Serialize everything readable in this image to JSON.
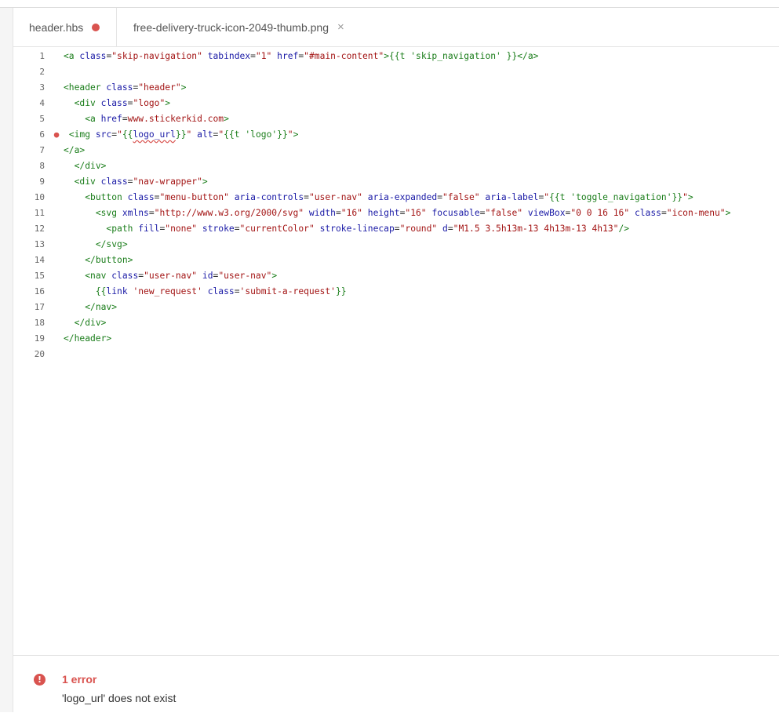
{
  "tabs": [
    {
      "label": "header.hbs",
      "modified": true
    },
    {
      "label": "free-delivery-truck-icon-2049-thumb.png",
      "close": "×"
    }
  ],
  "editor": {
    "lines": [
      {
        "n": "1",
        "html": "<span class=\"tag\">&lt;a</span> <span class=\"an\">class</span>=<span class=\"av\">\"skip-navigation\"</span> <span class=\"an\">tabindex</span>=<span class=\"av\">\"1\"</span> <span class=\"an\">href</span>=<span class=\"av\">\"#main-content\"</span><span class=\"tag\">&gt;</span><span class=\"hb\">{{t 'skip_navigation' }}</span><span class=\"tag\">&lt;/a&gt;</span>"
      },
      {
        "n": "2",
        "html": ""
      },
      {
        "n": "3",
        "html": "<span class=\"tag\">&lt;header</span> <span class=\"an\">class</span>=<span class=\"av\">\"header\"</span><span class=\"tag\">&gt;</span>"
      },
      {
        "n": "4",
        "html": "  <span class=\"tag\">&lt;div</span> <span class=\"an\">class</span>=<span class=\"av\">\"logo\"</span><span class=\"tag\">&gt;</span>"
      },
      {
        "n": "5",
        "html": "    <span class=\"tag\">&lt;a</span> <span class=\"an\">href</span>=<span class=\"av\">www.stickerkid.com</span><span class=\"tag\">&gt;</span>"
      },
      {
        "n": "6",
        "marker": "●",
        "html": " <span class=\"tag\">&lt;img</span> <span class=\"an\">src</span>=<span class=\"av\">\"</span><span class=\"hb\">{{</span><span class=\"hbid err-underline\">logo_url</span><span class=\"hb\">}}</span><span class=\"av\">\"</span> <span class=\"an\">alt</span>=<span class=\"av\">\"</span><span class=\"hb\">{{t 'logo'}}</span><span class=\"av\">\"</span><span class=\"tag\">&gt;</span>"
      },
      {
        "n": "7",
        "html": "<span class=\"tag\">&lt;/a&gt;</span>"
      },
      {
        "n": "8",
        "html": "  <span class=\"tag\">&lt;/div&gt;</span>"
      },
      {
        "n": "9",
        "html": "  <span class=\"tag\">&lt;div</span> <span class=\"an\">class</span>=<span class=\"av\">\"nav-wrapper\"</span><span class=\"tag\">&gt;</span>"
      },
      {
        "n": "10",
        "html": "    <span class=\"tag\">&lt;button</span> <span class=\"an\">class</span>=<span class=\"av\">\"menu-button\"</span> <span class=\"an\">aria-controls</span>=<span class=\"av\">\"user-nav\"</span> <span class=\"an\">aria-expanded</span>=<span class=\"av\">\"false\"</span> <span class=\"an\">aria-label</span>=<span class=\"av\">\"</span><span class=\"hb\">{{t 'toggle_navigation'}}</span><span class=\"av\">\"</span><span class=\"tag\">&gt;</span>"
      },
      {
        "n": "11",
        "html": "      <span class=\"tag\">&lt;svg</span> <span class=\"an\">xmlns</span>=<span class=\"av\">\"http://www.w3.org/2000/svg\"</span> <span class=\"an\">width</span>=<span class=\"av\">\"16\"</span> <span class=\"an\">height</span>=<span class=\"av\">\"16\"</span> <span class=\"an\">focusable</span>=<span class=\"av\">\"false\"</span> <span class=\"an\">viewBox</span>=<span class=\"av\">\"0 0 16 16\"</span> <span class=\"an\">class</span>=<span class=\"av\">\"icon-menu\"</span><span class=\"tag\">&gt;</span>"
      },
      {
        "n": "12",
        "html": "        <span class=\"tag\">&lt;path</span> <span class=\"an\">fill</span>=<span class=\"av\">\"none\"</span> <span class=\"an\">stroke</span>=<span class=\"av\">\"currentColor\"</span> <span class=\"an\">stroke-linecap</span>=<span class=\"av\">\"round\"</span> <span class=\"an\">d</span>=<span class=\"av\">\"M1.5 3.5h13m-13 4h13m-13 4h13\"</span><span class=\"tag\">/&gt;</span>"
      },
      {
        "n": "13",
        "html": "      <span class=\"tag\">&lt;/svg&gt;</span>"
      },
      {
        "n": "14",
        "html": "    <span class=\"tag\">&lt;/button&gt;</span>"
      },
      {
        "n": "15",
        "html": "    <span class=\"tag\">&lt;nav</span> <span class=\"an\">class</span>=<span class=\"av\">\"user-nav\"</span> <span class=\"an\">id</span>=<span class=\"av\">\"user-nav\"</span><span class=\"tag\">&gt;</span>"
      },
      {
        "n": "16",
        "html": "      <span class=\"hb\">{{</span><span class=\"hbid\">link</span> <span class=\"av\">'new_request'</span> <span class=\"hbid\">class</span>=<span class=\"av\">'submit-a-request'</span><span class=\"hb\">}}</span>"
      },
      {
        "n": "17",
        "html": "    <span class=\"tag\">&lt;/nav&gt;</span>"
      },
      {
        "n": "18",
        "html": "  <span class=\"tag\">&lt;/div&gt;</span>"
      },
      {
        "n": "19",
        "html": "<span class=\"tag\">&lt;/header&gt;</span>"
      },
      {
        "n": "20",
        "html": ""
      }
    ]
  },
  "problems": {
    "icon": "!",
    "count_label": "1 error",
    "message": "'logo_url' does not exist"
  },
  "colors": {
    "error": "#d9534f",
    "tag": "#1a7d1a",
    "attr_name": "#1a1aa6",
    "attr_value": "#a31515"
  }
}
